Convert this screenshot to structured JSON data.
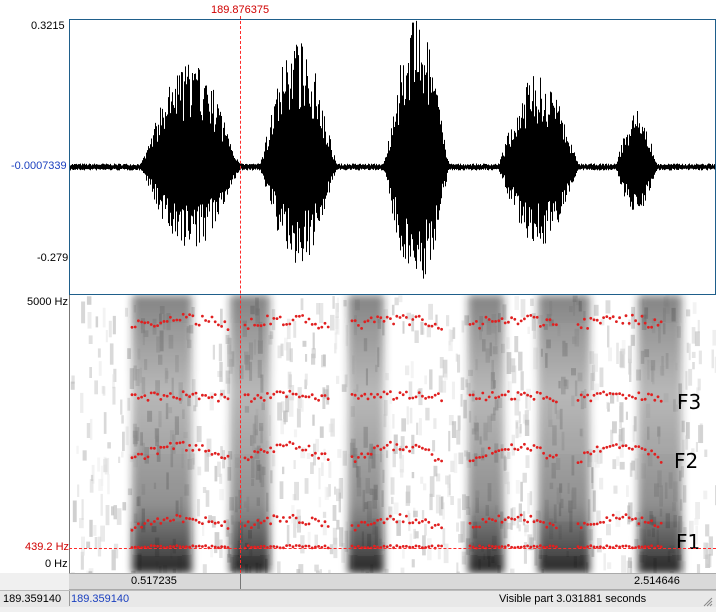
{
  "cursor": {
    "time": "189.876375",
    "frequency": "439.2 Hz"
  },
  "waveform": {
    "y_max": "0.3215",
    "y_zero": "-0.0007339",
    "y_min": "-0.279"
  },
  "spectrogram": {
    "f_max": "5000 Hz",
    "f_min": "0 Hz"
  },
  "formant_labels": {
    "f1": "F1",
    "f2": "F2",
    "f3": "F3"
  },
  "time_bar": {
    "left": "0.517235",
    "right": "2.514646"
  },
  "status_bar": {
    "start": "189.359140",
    "start_link": "189.359140",
    "visible": "Visible part 3.031881 seconds"
  },
  "colors": {
    "cursor": "#ff2a2a",
    "formant": "#e02020",
    "waveform": "#000000",
    "border": "#1f5f8b"
  }
}
